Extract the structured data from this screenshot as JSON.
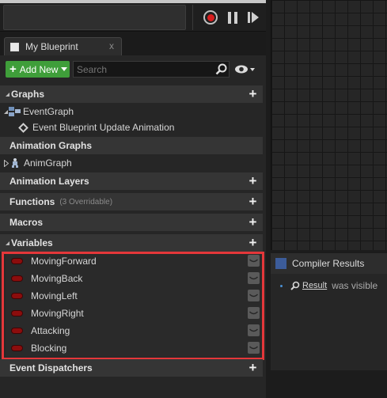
{
  "toolbar": {
    "record_icon": "record-icon",
    "pause_icon": "pause-icon",
    "step_icon": "step-icon"
  },
  "tab": {
    "label": "My Blueprint",
    "close": "x"
  },
  "actions": {
    "add_new_label": "Add New",
    "search_placeholder": "Search"
  },
  "sections": {
    "graphs": "Graphs",
    "event_graph": "EventGraph",
    "event_update": "Event Blueprint Update Animation",
    "animation_graphs": "Animation Graphs",
    "anim_graph": "AnimGraph",
    "animation_layers": "Animation Layers",
    "functions": "Functions",
    "functions_sub": "(3 Overridable)",
    "macros": "Macros",
    "variables": "Variables",
    "event_dispatchers": "Event Dispatchers"
  },
  "variables": [
    "MovingForward",
    "MovingBack",
    "MovingLeft",
    "MovingRight",
    "Attacking",
    "Blocking"
  ],
  "compiler": {
    "tab_label": "Compiler Results",
    "result_link": "Result",
    "message": "was visible"
  },
  "colors": {
    "add_green": "#3f9e3a",
    "variable_pill": "#8c0d0d",
    "highlight": "#e4373a"
  }
}
